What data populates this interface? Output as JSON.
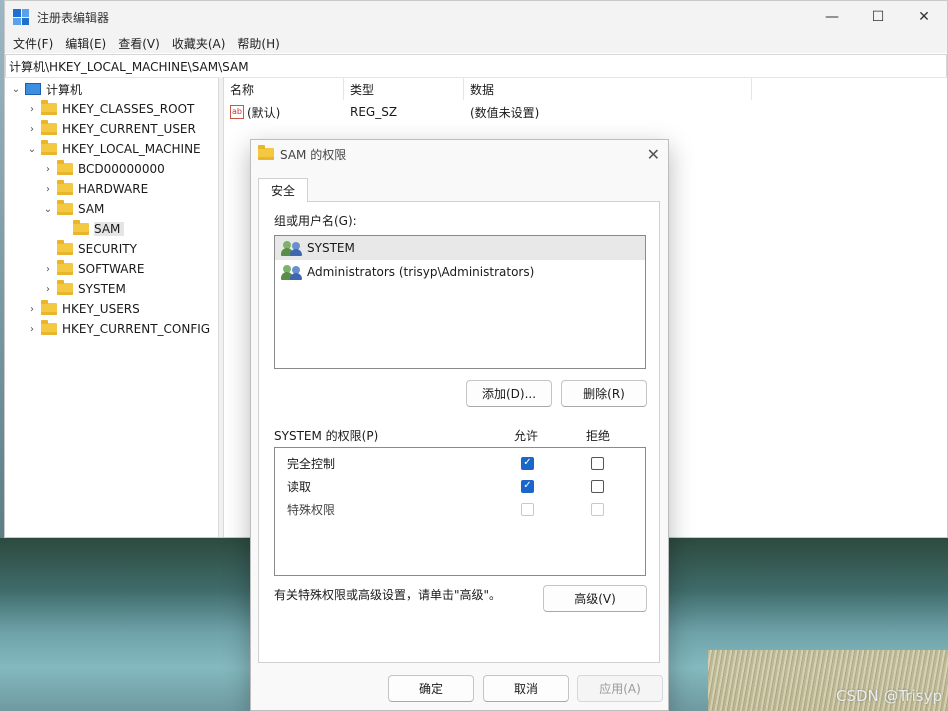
{
  "window": {
    "title": "注册表编辑器",
    "minimize": "—",
    "maximize": "☐",
    "close": "✕"
  },
  "menu": [
    "文件(F)",
    "编辑(E)",
    "查看(V)",
    "收藏夹(A)",
    "帮助(H)"
  ],
  "address": "计算机\\HKEY_LOCAL_MACHINE\\SAM\\SAM",
  "tree": {
    "root": "计算机",
    "items": [
      {
        "label": "HKEY_CLASSES_ROOT",
        "expander": "›"
      },
      {
        "label": "HKEY_CURRENT_USER",
        "expander": "›"
      },
      {
        "label": "HKEY_LOCAL_MACHINE",
        "expander": "⌄"
      },
      {
        "label": "BCD00000000",
        "expander": "›"
      },
      {
        "label": "HARDWARE",
        "expander": "›"
      },
      {
        "label": "SAM",
        "expander": "⌄"
      },
      {
        "label": "SAM",
        "expander": ""
      },
      {
        "label": "SECURITY",
        "expander": ""
      },
      {
        "label": "SOFTWARE",
        "expander": "›"
      },
      {
        "label": "SYSTEM",
        "expander": "›"
      },
      {
        "label": "HKEY_USERS",
        "expander": "›"
      },
      {
        "label": "HKEY_CURRENT_CONFIG",
        "expander": "›"
      }
    ]
  },
  "list": {
    "columns": [
      "名称",
      "类型",
      "数据"
    ],
    "rows": [
      {
        "name": "(默认)",
        "type": "REG_SZ",
        "data": "(数值未设置)",
        "icon": "ab"
      }
    ]
  },
  "dialog": {
    "title": "SAM 的权限",
    "tab": "安全",
    "group_label": "组或用户名(G):",
    "users": [
      "SYSTEM",
      "Administrators (trisyp\\Administrators)"
    ],
    "add_button": "添加(D)...",
    "remove_button": "删除(R)",
    "perm_label": "SYSTEM 的权限(P)",
    "allow_header": "允许",
    "deny_header": "拒绝",
    "permissions": [
      {
        "name": "完全控制",
        "allow": true,
        "deny": false,
        "enabled": true
      },
      {
        "name": "读取",
        "allow": true,
        "deny": false,
        "enabled": true
      },
      {
        "name": "特殊权限",
        "allow": false,
        "deny": false,
        "enabled": false
      }
    ],
    "advanced_hint": "有关特殊权限或高级设置，请单击\"高级\"。",
    "advanced_button": "高级(V)",
    "ok_button": "确定",
    "cancel_button": "取消",
    "apply_button": "应用(A)",
    "close": "✕"
  },
  "watermark": "CSDN @Trisyp",
  "colors": {
    "accent": "#1b67c9",
    "folder": "#f5c842"
  }
}
